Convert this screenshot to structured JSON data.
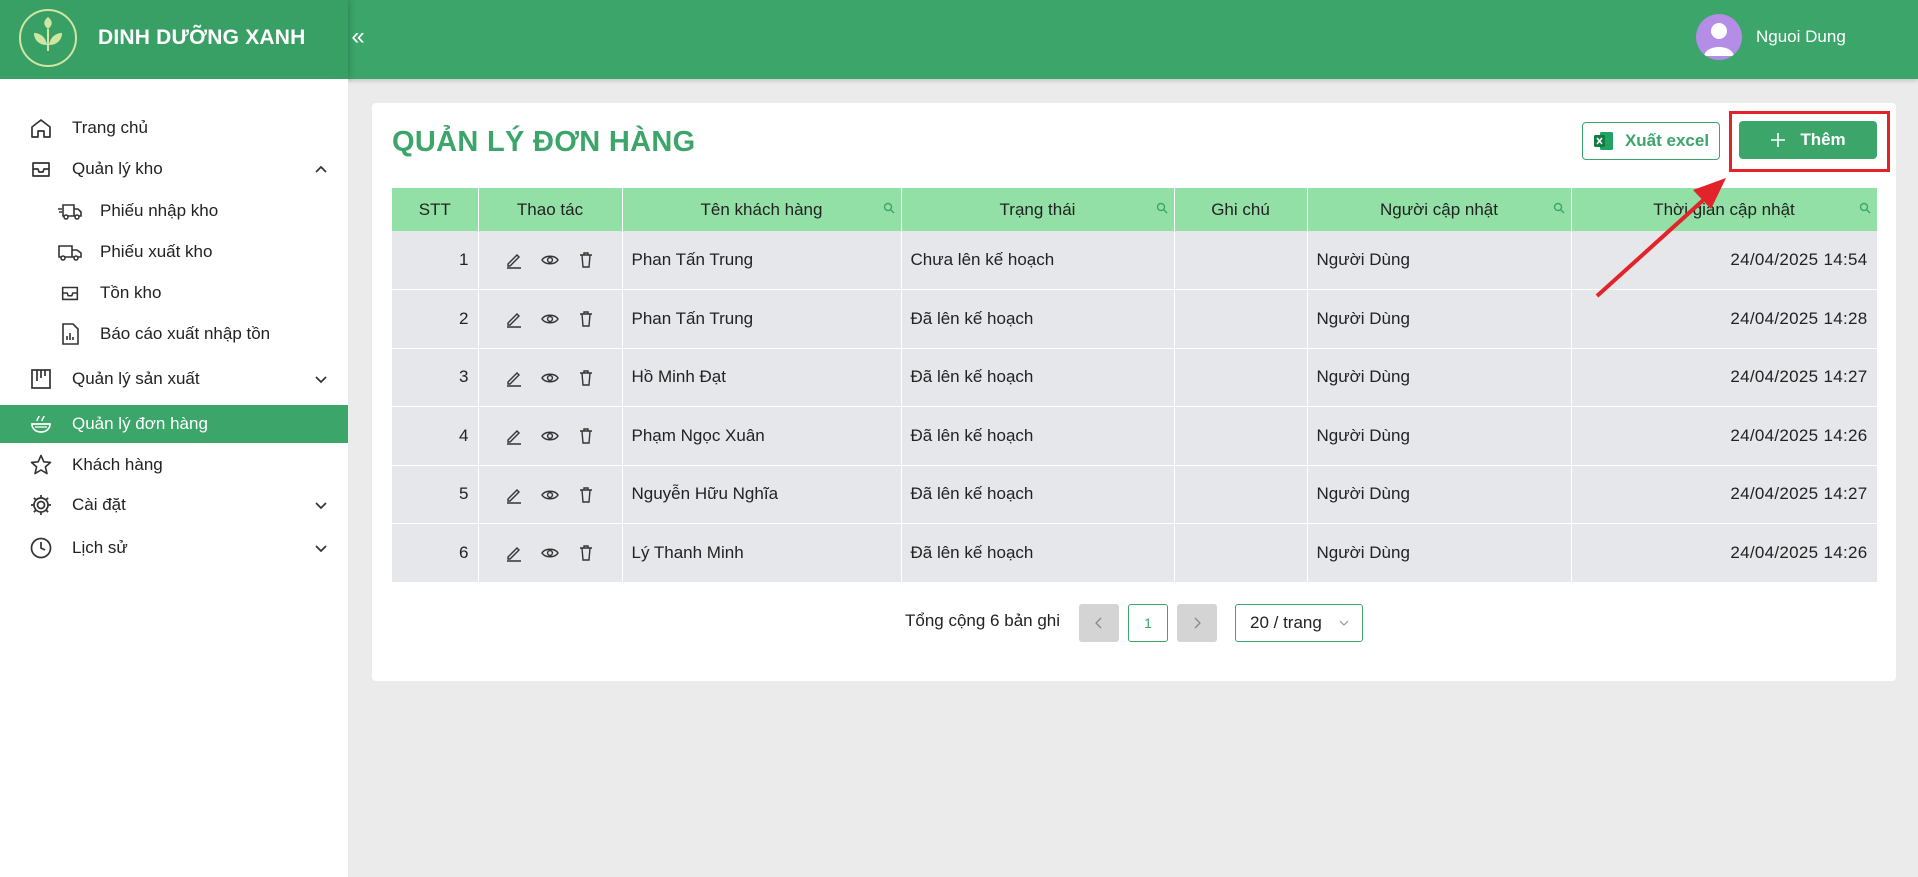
{
  "app": {
    "brand": "DINH DƯỠNG XANH",
    "user_name": "Nguoi Dung"
  },
  "sidebar": {
    "items": [
      {
        "label": "Trang chủ",
        "icon": "home-icon"
      },
      {
        "label": "Quản lý kho",
        "icon": "inbox-icon",
        "expanded": true
      },
      {
        "label": "Phiếu nhập kho",
        "icon": "truck-import-icon"
      },
      {
        "label": "Phiếu xuất kho",
        "icon": "truck-export-icon"
      },
      {
        "label": "Tồn kho",
        "icon": "inbox-icon"
      },
      {
        "label": "Báo cáo xuất nhập tồn",
        "icon": "report-file-icon"
      },
      {
        "label": "Quản lý sản xuất",
        "icon": "factory-icon"
      },
      {
        "label": "Quản lý đơn hàng",
        "icon": "order-bowl-icon",
        "active": true
      },
      {
        "label": "Khách hàng",
        "icon": "star-icon"
      },
      {
        "label": "Cài đặt",
        "icon": "gear-icon"
      },
      {
        "label": "Lịch sử",
        "icon": "clock-icon"
      }
    ]
  },
  "page": {
    "title": "QUẢN LÝ ĐƠN HÀNG",
    "export_label": "Xuất excel",
    "add_label": "Thêm"
  },
  "table": {
    "headers": [
      "STT",
      "Thao tác",
      "Tên khách hàng",
      "Trạng thái",
      "Ghi chú",
      "Người cập nhật",
      "Thời gian cập nhật"
    ],
    "rows": [
      {
        "stt": "1",
        "customer": "Phan Tấn Trung",
        "status": "Chưa lên kế hoạch",
        "note": "",
        "updated_by": "Người Dùng",
        "updated_at": "24/04/2025 14:54"
      },
      {
        "stt": "2",
        "customer": "Phan Tấn Trung",
        "status": "Đã lên kế hoạch",
        "note": "",
        "updated_by": "Người Dùng",
        "updated_at": "24/04/2025 14:28"
      },
      {
        "stt": "3",
        "customer": "Hồ Minh Đạt",
        "status": "Đã lên kế hoạch",
        "note": "",
        "updated_by": "Người Dùng",
        "updated_at": "24/04/2025 14:27"
      },
      {
        "stt": "4",
        "customer": "Phạm Ngọc Xuân",
        "status": "Đã lên kế hoạch",
        "note": "",
        "updated_by": "Người Dùng",
        "updated_at": "24/04/2025 14:26"
      },
      {
        "stt": "5",
        "customer": "Nguyễn Hữu Nghĩa",
        "status": "Đã lên kế hoạch",
        "note": "",
        "updated_by": "Người Dùng",
        "updated_at": "24/04/2025 14:27"
      },
      {
        "stt": "6",
        "customer": "Lý Thanh Minh",
        "status": "Đã lên kế hoạch",
        "note": "",
        "updated_by": "Người Dùng",
        "updated_at": "24/04/2025 14:26"
      }
    ]
  },
  "pagination": {
    "total_text": "Tổng cộng 6 bản ghi",
    "current_page": "1",
    "page_size": "20 / trang"
  },
  "colors": {
    "primary": "#3ba56a",
    "table_header": "#93e0a6",
    "highlight": "#e3232a"
  }
}
